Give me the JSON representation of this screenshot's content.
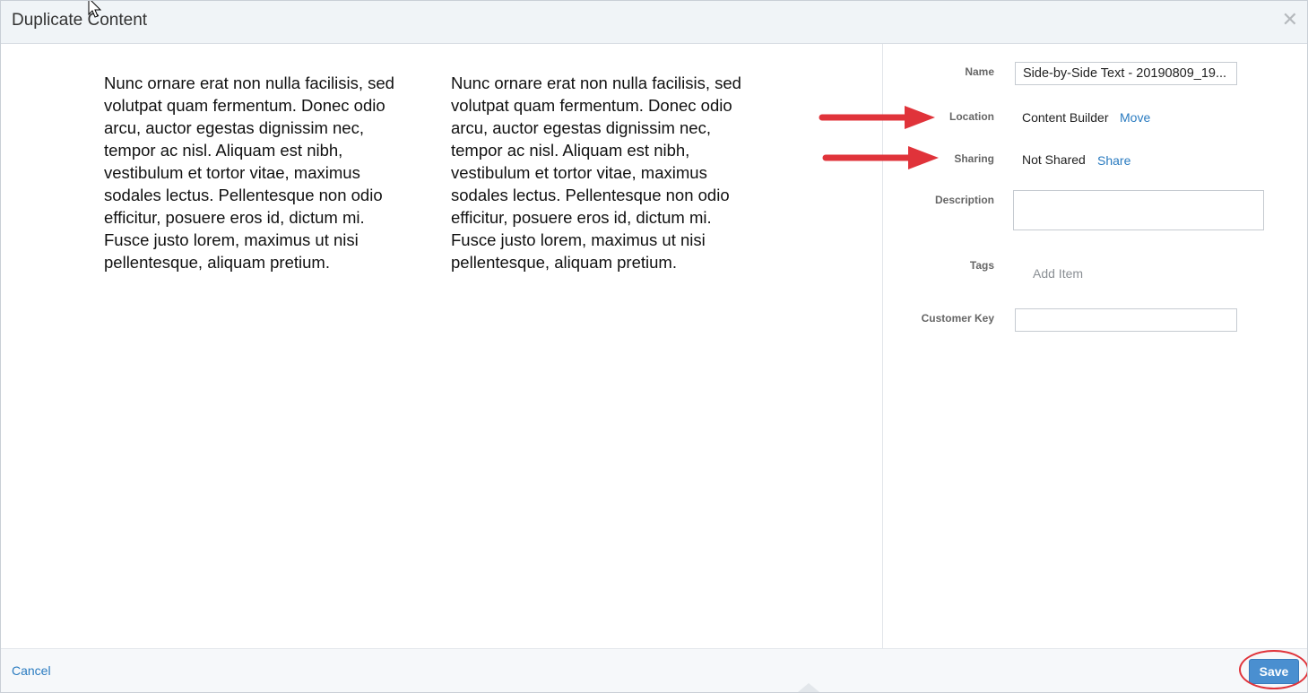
{
  "dialog": {
    "title": "Duplicate Content",
    "close_icon": "close-icon"
  },
  "preview": {
    "left_text": "Nunc ornare erat non nulla facilisis, sed volutpat quam fermentum. Donec odio arcu, auctor egestas dignissim nec, tempor ac nisl. Aliquam est nibh, vestibulum et tortor vitae, maximus sodales lectus. Pellentesque non odio efficitur, posuere eros id, dictum mi. Fusce justo lorem, maximus ut nisi pellentesque, aliquam pretium.",
    "right_text": "Nunc ornare erat non nulla facilisis, sed volutpat quam fermentum. Donec odio arcu, auctor egestas dignissim nec, tempor ac nisl. Aliquam est nibh, vestibulum et tortor vitae, maximus sodales lectus. Pellentesque non odio efficitur, posuere eros id, dictum mi. Fusce justo lorem, maximus ut nisi pellentesque, aliquam pretium."
  },
  "properties": {
    "name_label": "Name",
    "name_value": "Side-by-Side Text - 20190809_19...",
    "location_label": "Location",
    "location_value": "Content Builder",
    "location_link": "Move",
    "sharing_label": "Sharing",
    "sharing_value": "Not Shared",
    "sharing_link": "Share",
    "description_label": "Description",
    "description_value": "",
    "tags_label": "Tags",
    "tags_add": "Add Item",
    "customer_key_label": "Customer Key",
    "customer_key_value": ""
  },
  "footer": {
    "cancel_label": "Cancel",
    "save_label": "Save"
  },
  "colors": {
    "link": "#2a7bc0",
    "save_button": "#4a8fd0",
    "annotation_red": "#e0333a"
  }
}
